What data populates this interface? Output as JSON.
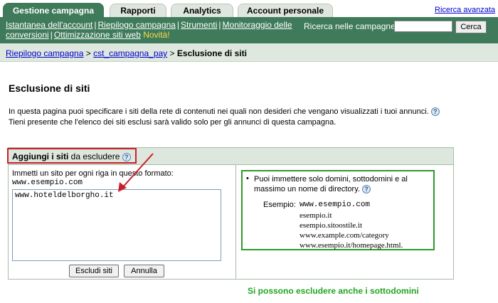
{
  "tabs": [
    {
      "label": "Gestione campagna",
      "active": true
    },
    {
      "label": "Rapporti",
      "active": false
    },
    {
      "label": "Analytics",
      "active": false
    },
    {
      "label": "Account personale",
      "active": false
    }
  ],
  "advanced_search": "Ricerca avanzata",
  "nav": {
    "links": [
      "Istantanea dell'account",
      "Riepilogo campagna",
      "Strumenti",
      "Monitoraggio delle conversioni",
      "Ottimizzazione siti web"
    ],
    "new_badge": "Novità!",
    "search_label": "Ricerca nelle campagne:",
    "search_value": "",
    "search_button": "Cerca"
  },
  "breadcrumb": {
    "items": [
      "Riepilogo campagna",
      "cst_campagna_pay"
    ],
    "separator": ">",
    "current": "Esclusione di siti"
  },
  "page": {
    "title": "Esclusione di siti",
    "intro_line1": "In questa pagina puoi specificare i siti della rete di contenuti nei quali non desideri che vengano visualizzati i tuoi annunci.",
    "intro_line2": "Tieni presente che l'elenco dei siti esclusi sarà valido solo per gli annunci di questa campagna."
  },
  "panel": {
    "header_bold": "Aggiungi i siti",
    "header_rest": "da escludere",
    "format_label": "Immetti un sito per ogni riga in questo formato:",
    "format_example": "www.esempio.com",
    "sites_value": "www.hoteldelborgho.it",
    "exclude_button": "Escludi siti",
    "cancel_button": "Annulla"
  },
  "note": {
    "text": "Puoi immettere solo domini, sottodomini e al massimo un nome di directory.",
    "example_label": "Esempio:",
    "examples": [
      "www.esempio.com",
      "esempio.it",
      "esempio.sitoostile.it",
      "www.example.com/category",
      "www.esempio.it/homepage.html."
    ]
  },
  "annotation": "Si possono escludere anche i sottodomini",
  "colors": {
    "nav_green": "#3f7a5a",
    "highlight_red": "#c8202a",
    "note_green": "#22a522",
    "link_blue": "#0000cc"
  },
  "icons": [
    "help-icon",
    "arrow-icon"
  ]
}
